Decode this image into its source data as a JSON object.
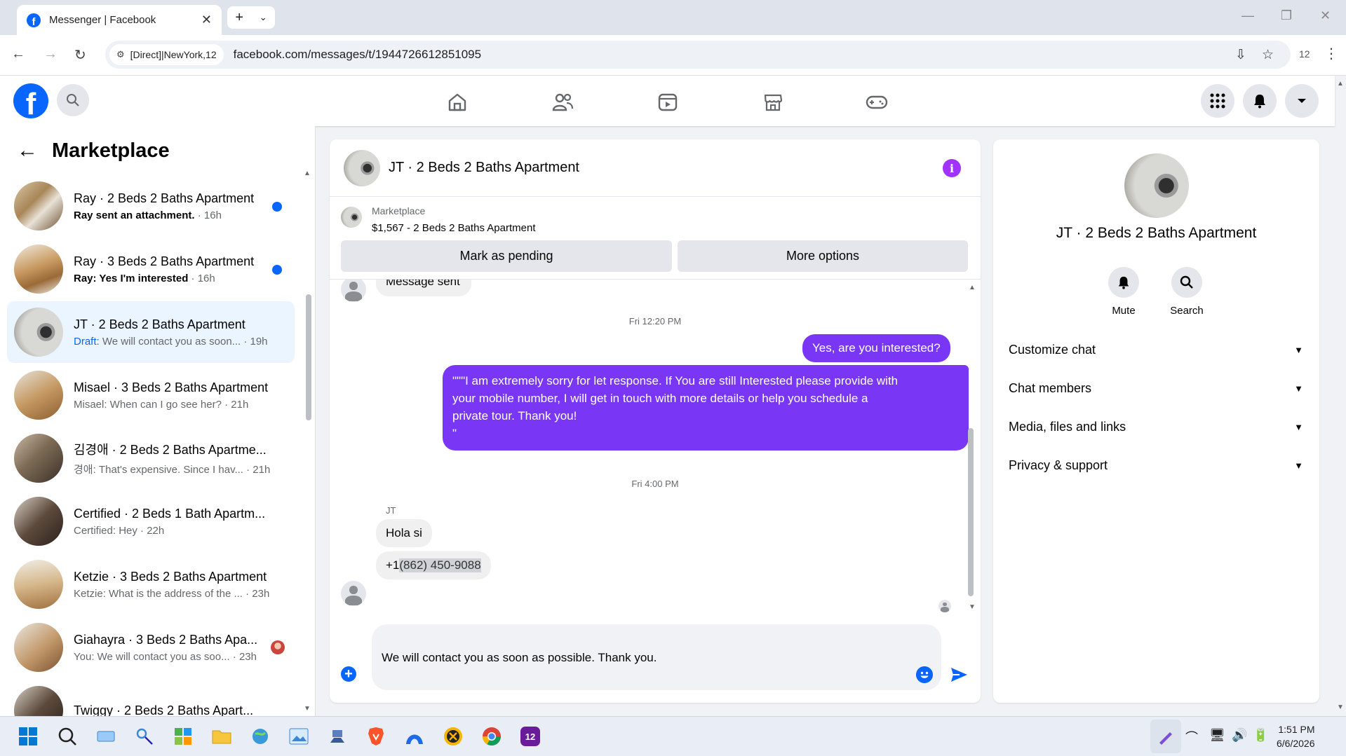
{
  "browser": {
    "tab_title": "Messenger | Facebook",
    "site_chip": "[Direct]|NewYork,12",
    "url": "facebook.com/messages/t/1944726612851095",
    "profile_count": "12"
  },
  "sidebar": {
    "title": "Marketplace",
    "conversations": [
      {
        "name": "Ray · 2 Beds 2 Baths Apartment",
        "preview": "Ray sent an attachment.",
        "time": " · 16h",
        "unread": true
      },
      {
        "name": "Ray · 3 Beds 2 Baths Apartment",
        "preview": "Ray: Yes I'm interested",
        "time": " · 16h",
        "unread": true
      },
      {
        "name": "JT · 2 Beds 2 Baths Apartment",
        "draft_label": "Draft:",
        "preview": " We will contact you as soon...",
        "time": " · 19h",
        "active": true
      },
      {
        "name": "Misael · 3 Beds 2 Baths Apartment",
        "preview": "Misael: When can I go see her?",
        "time": " · 21h"
      },
      {
        "name": "김경애 · 2 Beds 2 Baths Apartme...",
        "preview": "경애: That's expensive. Since I hav...",
        "time": " · 21h"
      },
      {
        "name": "Certified · 2 Beds 1 Bath Apartm...",
        "preview": "Certified: Hey",
        "time": " · 22h"
      },
      {
        "name": "Ketzie · 3 Beds 2 Baths Apartment",
        "preview": "Ketzie: What is the address of the ...",
        "time": " · 23h"
      },
      {
        "name": "Giahayra · 3 Beds 2 Baths Apa...",
        "preview": "You: We will contact you as soo...",
        "time": " · 23h"
      },
      {
        "name": "Twiggy · 2 Beds 2 Baths Apart...",
        "preview": "",
        "time": ""
      }
    ]
  },
  "chat": {
    "title": "JT · 2 Beds 2 Baths Apartment",
    "listing_source": "Marketplace",
    "listing_price": "$1,567 - 2 Beds 2 Baths Apartment",
    "mark_pending": "Mark as pending",
    "more_options": "More options",
    "partial_msg": "Message sent",
    "ts1": "Fri 12:20 PM",
    "out1": "Yes, are you interested?",
    "out2_line1": "\"\"\"I am extremely sorry for let response. If You are still Interested please provide with",
    "out2_line2": "your mobile number, I will get in touch with more details or help you schedule a",
    "out2_line3": "private tour. Thank you!",
    "out2_line4": "\"",
    "ts2": "Fri 4:00 PM",
    "sender": "JT",
    "in1": "Hola si",
    "in2_prefix": "+1 ",
    "in2_phone": "(862) 450-9088",
    "composer_value": "We will contact you as soon as possible. Thank you."
  },
  "info": {
    "name": "JT · 2 Beds 2 Baths Apartment",
    "mute": "Mute",
    "search": "Search",
    "sections": [
      "Customize chat",
      "Chat members",
      "Media, files and links",
      "Privacy & support"
    ]
  },
  "taskbar": {
    "time": "1:51 PM",
    "date": "6/6/2026",
    "badge": "12"
  },
  "colors": {
    "fb_blue": "#0866ff",
    "outgoing_bubble": "#7a36f5",
    "info_icon": "#a033ff"
  }
}
